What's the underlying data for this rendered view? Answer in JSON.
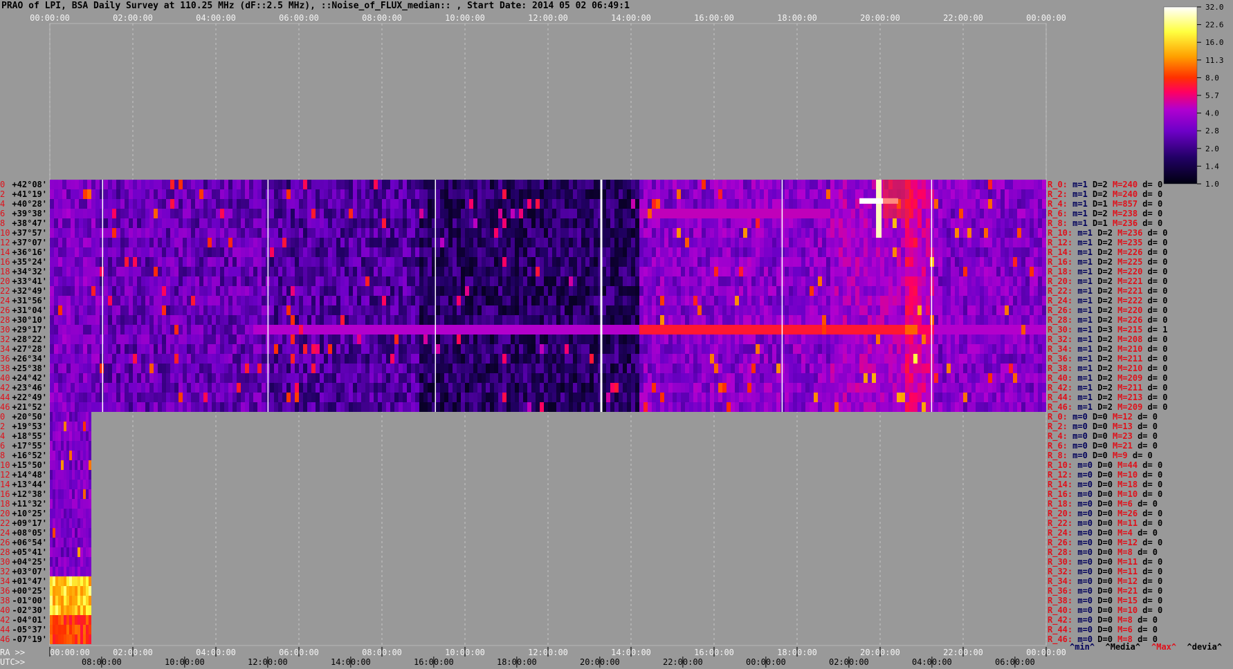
{
  "title": "PRAO of LPI, BSA Daily Survey at 110.25 MHz (dF::2.5 MHz), ::Noise_of_FLUX_median:: , Start Date: 2014 05 02 06:49:1",
  "colors": {
    "background": "#999999",
    "plot_background": "#000010",
    "label_red": "#e0101a",
    "label_navy": "#00005a"
  },
  "chart_data": {
    "type": "heatmap",
    "colormap_stops": [
      "#000010",
      "#220066",
      "#6e00c8",
      "#b000d0",
      "#ff0060",
      "#ff3000",
      "#ffa000",
      "#ffff40",
      "#ffffff"
    ],
    "colorbar": {
      "ticks": [
        "32.0",
        "22.6",
        "16.0",
        "11.3",
        "8.0",
        "5.7",
        "4.0",
        "2.8",
        "2.0",
        "1.4",
        "1.0"
      ]
    },
    "top_axis": {
      "ticks": [
        "00:00:00",
        "02:00:00",
        "04:00:00",
        "06:00:00",
        "08:00:00",
        "10:00:00",
        "12:00:00",
        "14:00:00",
        "16:00:00",
        "18:00:00",
        "20:00:00",
        "22:00:00",
        "00:00:00"
      ]
    },
    "ra_axis": {
      "prefix": "RA >>",
      "ticks": [
        "00:00:00",
        "02:00:00",
        "04:00:00",
        "06:00:00",
        "08:00:00",
        "10:00:00",
        "12:00:00",
        "14:00:00",
        "16:00:00",
        "18:00:00",
        "20:00:00",
        "22:00:00",
        "00:00:00"
      ]
    },
    "utc_axis": {
      "prefix": "UTC>>",
      "ticks": [
        "08:00:00",
        "10:00:00",
        "12:00:00",
        "14:00:00",
        "16:00:00",
        "18:00:00",
        "20:00:00",
        "22:00:00",
        "00:00:00",
        "02:00:00",
        "04:00:00",
        "06:00:00"
      ]
    },
    "upper_block": {
      "declinations": [
        "+42°08'",
        "+41°19'",
        "+40°28'",
        "+39°38'",
        "+38°47'",
        "+37°57'",
        "+37°07'",
        "+36°16'",
        "+35°24'",
        "+34°32'",
        "+33°41'",
        "+32°49'",
        "+31°56'",
        "+31°04'",
        "+30°10'",
        "+29°17'",
        "+28°22'",
        "+27°28'",
        "+26°34'",
        "+25°38'",
        "+24°42'",
        "+23°46'",
        "+22°49'",
        "+21°52'"
      ],
      "stats": [
        {
          "r": "R_0:",
          "m": 1,
          "D": 2,
          "M": 240,
          "d": 0
        },
        {
          "r": "R_2:",
          "m": 1,
          "D": 2,
          "M": 240,
          "d": 0
        },
        {
          "r": "R_4:",
          "m": 1,
          "D": 1,
          "M": 857,
          "d": 0
        },
        {
          "r": "R_6:",
          "m": 1,
          "D": 2,
          "M": 238,
          "d": 0
        },
        {
          "r": "R_8:",
          "m": 1,
          "D": 1,
          "M": 236,
          "d": 0
        },
        {
          "r": "R_10:",
          "m": 1,
          "D": 2,
          "M": 236,
          "d": 0
        },
        {
          "r": "R_12:",
          "m": 1,
          "D": 2,
          "M": 235,
          "d": 0
        },
        {
          "r": "R_14:",
          "m": 1,
          "D": 2,
          "M": 226,
          "d": 0
        },
        {
          "r": "R_16:",
          "m": 1,
          "D": 2,
          "M": 225,
          "d": 0
        },
        {
          "r": "R_18:",
          "m": 1,
          "D": 2,
          "M": 220,
          "d": 0
        },
        {
          "r": "R_20:",
          "m": 1,
          "D": 2,
          "M": 221,
          "d": 0
        },
        {
          "r": "R_22:",
          "m": 1,
          "D": 2,
          "M": 221,
          "d": 0
        },
        {
          "r": "R_24:",
          "m": 1,
          "D": 2,
          "M": 222,
          "d": 0
        },
        {
          "r": "R_26:",
          "m": 1,
          "D": 2,
          "M": 220,
          "d": 0
        },
        {
          "r": "R_28:",
          "m": 1,
          "D": 2,
          "M": 226,
          "d": 0
        },
        {
          "r": "R_30:",
          "m": 1,
          "D": 3,
          "M": 215,
          "d": 1
        },
        {
          "r": "R_32:",
          "m": 1,
          "D": 2,
          "M": 208,
          "d": 0
        },
        {
          "r": "R_34:",
          "m": 1,
          "D": 2,
          "M": 210,
          "d": 0
        },
        {
          "r": "R_36:",
          "m": 1,
          "D": 2,
          "M": 211,
          "d": 0
        },
        {
          "r": "R_38:",
          "m": 1,
          "D": 2,
          "M": 210,
          "d": 0
        },
        {
          "r": "R_40:",
          "m": 1,
          "D": 2,
          "M": 209,
          "d": 0
        },
        {
          "r": "R_42:",
          "m": 1,
          "D": 2,
          "M": 211,
          "d": 0
        },
        {
          "r": "R_44:",
          "m": 1,
          "D": 2,
          "M": 213,
          "d": 0
        },
        {
          "r": "R_46:",
          "m": 1,
          "D": 2,
          "M": 209,
          "d": 0
        }
      ]
    },
    "lower_block": {
      "declinations": [
        "+20°50'",
        "+19°53'",
        "+18°55'",
        "+17°55'",
        "+16°52'",
        "+15°50'",
        "+14°48'",
        "+13°44'",
        "+12°38'",
        "+11°32'",
        "+10°25'",
        "+09°17'",
        "+08°05'",
        "+06°54'",
        "+05°41'",
        "+04°25'",
        "+03°07'",
        "+01°47'",
        "+00°25'",
        "-01°00'",
        "-02°30'",
        "-04°01'",
        "-05°37'",
        "-07°19'"
      ],
      "stats": [
        {
          "r": "R_0:",
          "m": 0,
          "D": 0,
          "M": 12,
          "d": 0
        },
        {
          "r": "R_2:",
          "m": 0,
          "D": 0,
          "M": 13,
          "d": 0
        },
        {
          "r": "R_4:",
          "m": 0,
          "D": 0,
          "M": 23,
          "d": 0
        },
        {
          "r": "R_6:",
          "m": 0,
          "D": 0,
          "M": 21,
          "d": 0
        },
        {
          "r": "R_8:",
          "m": 0,
          "D": 0,
          "M": 9,
          "d": 0
        },
        {
          "r": "R_10:",
          "m": 0,
          "D": 0,
          "M": 44,
          "d": 0
        },
        {
          "r": "R_12:",
          "m": 0,
          "D": 0,
          "M": 10,
          "d": 0
        },
        {
          "r": "R_14:",
          "m": 0,
          "D": 0,
          "M": 18,
          "d": 0
        },
        {
          "r": "R_16:",
          "m": 0,
          "D": 0,
          "M": 10,
          "d": 0
        },
        {
          "r": "R_18:",
          "m": 0,
          "D": 0,
          "M": 6,
          "d": 0
        },
        {
          "r": "R_20:",
          "m": 0,
          "D": 0,
          "M": 26,
          "d": 0
        },
        {
          "r": "R_22:",
          "m": 0,
          "D": 0,
          "M": 11,
          "d": 0
        },
        {
          "r": "R_24:",
          "m": 0,
          "D": 0,
          "M": 4,
          "d": 0
        },
        {
          "r": "R_26:",
          "m": 0,
          "D": 0,
          "M": 12,
          "d": 0
        },
        {
          "r": "R_28:",
          "m": 0,
          "D": 0,
          "M": 8,
          "d": 0
        },
        {
          "r": "R_30:",
          "m": 0,
          "D": 0,
          "M": 11,
          "d": 0
        },
        {
          "r": "R_32:",
          "m": 0,
          "D": 0,
          "M": 11,
          "d": 0
        },
        {
          "r": "R_34:",
          "m": 0,
          "D": 0,
          "M": 12,
          "d": 0
        },
        {
          "r": "R_36:",
          "m": 0,
          "D": 0,
          "M": 21,
          "d": 0
        },
        {
          "r": "R_38:",
          "m": 0,
          "D": 0,
          "M": 15,
          "d": 0
        },
        {
          "r": "R_40:",
          "m": 0,
          "D": 0,
          "M": 10,
          "d": 0
        },
        {
          "r": "R_42:",
          "m": 0,
          "D": 0,
          "M": 8,
          "d": 0
        },
        {
          "r": "R_44:",
          "m": 0,
          "D": 0,
          "M": 6,
          "d": 0
        },
        {
          "r": "R_46:",
          "m": 0,
          "D": 0,
          "M": 8,
          "d": 0
        }
      ]
    },
    "legend_footer": [
      {
        "text": "^min^",
        "color": "#00005a"
      },
      {
        "text": "^Media^",
        "color": "#000000"
      },
      {
        "text": "^Max^",
        "color": "#e0101a"
      },
      {
        "text": "^devia^",
        "color": "#000000"
      }
    ]
  }
}
